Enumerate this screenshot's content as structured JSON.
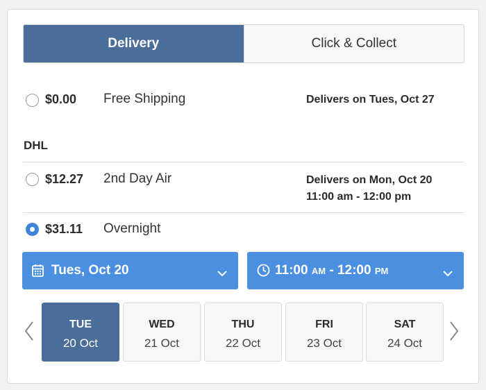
{
  "tabs": [
    {
      "label": "Delivery",
      "active": true
    },
    {
      "label": "Click & Collect",
      "active": false
    }
  ],
  "options": [
    {
      "price": "$0.00",
      "method": "Free Shipping",
      "delivery_line1": "Delivers on Tues, Oct 27",
      "delivery_line2": "",
      "selected": false
    },
    {
      "price": "$12.27",
      "method": "2nd Day Air",
      "delivery_line1": "Delivers on Mon, Oct 20",
      "delivery_line2": "11:00 am - 12:00 pm",
      "selected": false
    },
    {
      "price": "$31.11",
      "method": "Overnight",
      "delivery_line1": "",
      "delivery_line2": "",
      "selected": true
    }
  ],
  "carrier": "DHL",
  "date_select": {
    "value": "Tues, Oct 20",
    "icon": "calendar-icon"
  },
  "time_select": {
    "start": "11:00",
    "start_ampm": "AM",
    "sep": " - ",
    "end": "12:00",
    "end_ampm": "PM",
    "icon": "clock-icon"
  },
  "days": [
    {
      "dow": "TUE",
      "date": "20 Oct",
      "selected": true
    },
    {
      "dow": "WED",
      "date": "21 Oct",
      "selected": false
    },
    {
      "dow": "THU",
      "date": "22 Oct",
      "selected": false
    },
    {
      "dow": "FRI",
      "date": "23 Oct",
      "selected": false
    },
    {
      "dow": "SAT",
      "date": "24 Oct",
      "selected": false
    }
  ],
  "colors": {
    "tab_active": "#4a6d99",
    "dropdown": "#4b8fe0",
    "radio_checked": "#3d86dc",
    "day_selected": "#4a6d99"
  }
}
